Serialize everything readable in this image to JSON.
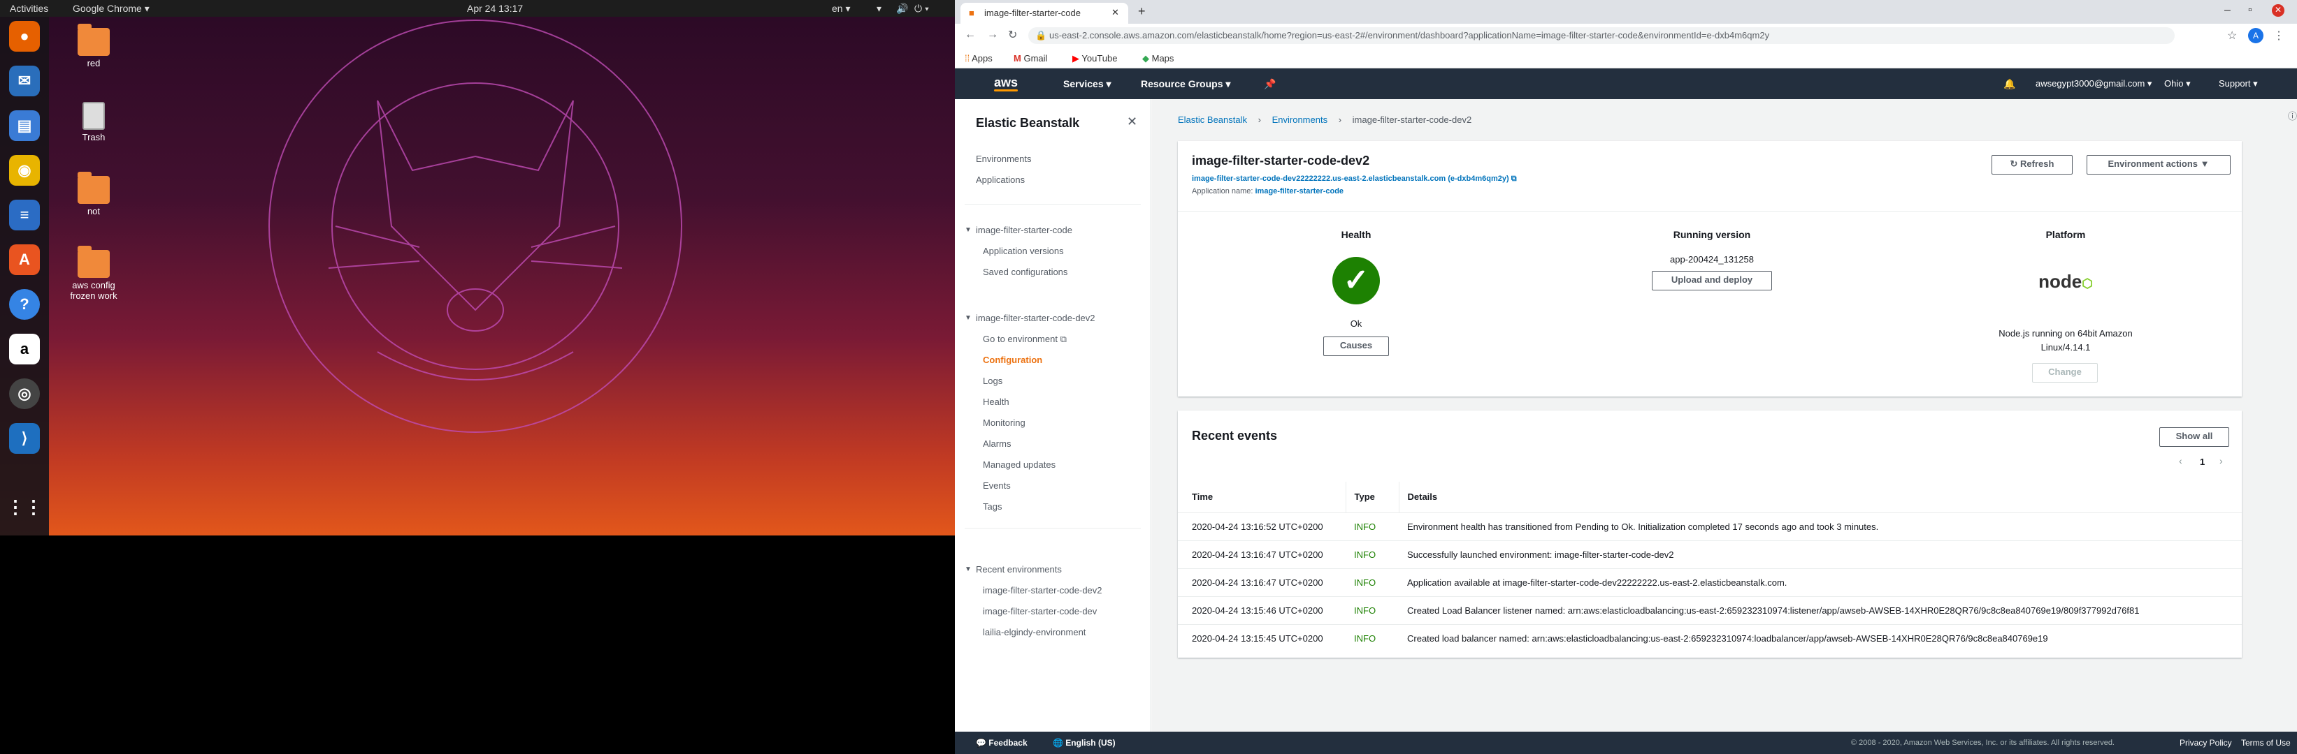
{
  "topbar": {
    "activities": "Activities",
    "app": "Google Chrome",
    "clock": "Apr 24  13:17",
    "lang": "en"
  },
  "desktop": {
    "icons": [
      {
        "label": "red"
      },
      {
        "label": "Trash"
      },
      {
        "label": "not"
      },
      {
        "label": "aws config frozen work"
      }
    ]
  },
  "browser": {
    "tab_title": "image-filter-starter-code",
    "url": "us-east-2.console.aws.amazon.com/elasticbeanstalk/home?region=us-east-2#/environment/dashboard?applicationName=image-filter-starter-code&environmentId=e-dxb4m6qm2y",
    "profile": "A",
    "bookmarks": [
      "Apps",
      "Gmail",
      "YouTube",
      "Maps"
    ]
  },
  "awsnav": {
    "logo": "aws",
    "services": "Services",
    "resource_groups": "Resource Groups",
    "account": "awsegypt3000@gmail.com",
    "region": "Ohio",
    "support": "Support"
  },
  "sidebar": {
    "title": "Elastic Beanstalk",
    "items": [
      "Environments",
      "Applications"
    ],
    "app_name": "image-filter-starter-code",
    "app_items": [
      "Application versions",
      "Saved configurations"
    ],
    "env_name": "image-filter-starter-code-dev2",
    "env_items": [
      "Go to environment",
      "Configuration",
      "Logs",
      "Health",
      "Monitoring",
      "Alarms",
      "Managed updates",
      "Events",
      "Tags"
    ],
    "recent_title": "Recent environments",
    "recent": [
      "image-filter-starter-code-dev2",
      "image-filter-starter-code-dev",
      "lailia-elgindy-environment"
    ]
  },
  "breadcrumb": [
    "Elastic Beanstalk",
    "Environments",
    "image-filter-starter-code-dev2"
  ],
  "env": {
    "name": "image-filter-starter-code-dev2",
    "url": "image-filter-starter-code-dev22222222.us-east-2.elasticbeanstalk.com (e-dxb4m6qm2y)",
    "app_label": "Application name: ",
    "app_name": "image-filter-starter-code",
    "refresh": "Refresh",
    "actions": "Environment actions",
    "health_title": "Health",
    "health_status": "Ok",
    "causes": "Causes",
    "running_title": "Running version",
    "version": "app-200424_131258",
    "upload": "Upload and deploy",
    "platform_title": "Platform",
    "platform_logo": "node",
    "platform_desc": "Node.js running on 64bit Amazon Linux/4.14.1",
    "change": "Change"
  },
  "events": {
    "title": "Recent events",
    "show_all": "Show all",
    "page": "1",
    "columns": [
      "Time",
      "Type",
      "Details"
    ],
    "rows": [
      {
        "time": "2020-04-24 13:16:52 UTC+0200",
        "type": "INFO",
        "details": "Environment health has transitioned from Pending to Ok. Initialization completed 17 seconds ago and took 3 minutes."
      },
      {
        "time": "2020-04-24 13:16:47 UTC+0200",
        "type": "INFO",
        "details": "Successfully launched environment: image-filter-starter-code-dev2"
      },
      {
        "time": "2020-04-24 13:16:47 UTC+0200",
        "type": "INFO",
        "details": "Application available at image-filter-starter-code-dev22222222.us-east-2.elasticbeanstalk.com."
      },
      {
        "time": "2020-04-24 13:15:46 UTC+0200",
        "type": "INFO",
        "details": "Created Load Balancer listener named: arn:aws:elasticloadbalancing:us-east-2:659232310974:listener/app/awseb-AWSEB-14XHR0E28QR76/9c8c8ea840769e19/809f377992d76f81"
      },
      {
        "time": "2020-04-24 13:15:45 UTC+0200",
        "type": "INFO",
        "details": "Created load balancer named: arn:aws:elasticloadbalancing:us-east-2:659232310974:loadbalancer/app/awseb-AWSEB-14XHR0E28QR76/9c8c8ea840769e19"
      }
    ]
  },
  "footer": {
    "feedback": "Feedback",
    "language": "English (US)",
    "copyright": "© 2008 - 2020, Amazon Web Services, Inc. or its affiliates. All rights reserved.",
    "privacy": "Privacy Policy",
    "terms": "Terms of Use"
  },
  "colors": {
    "aws_nav": "#232f3e",
    "accent": "#ec7211",
    "link": "#0073bb",
    "ok": "#1d8102"
  }
}
